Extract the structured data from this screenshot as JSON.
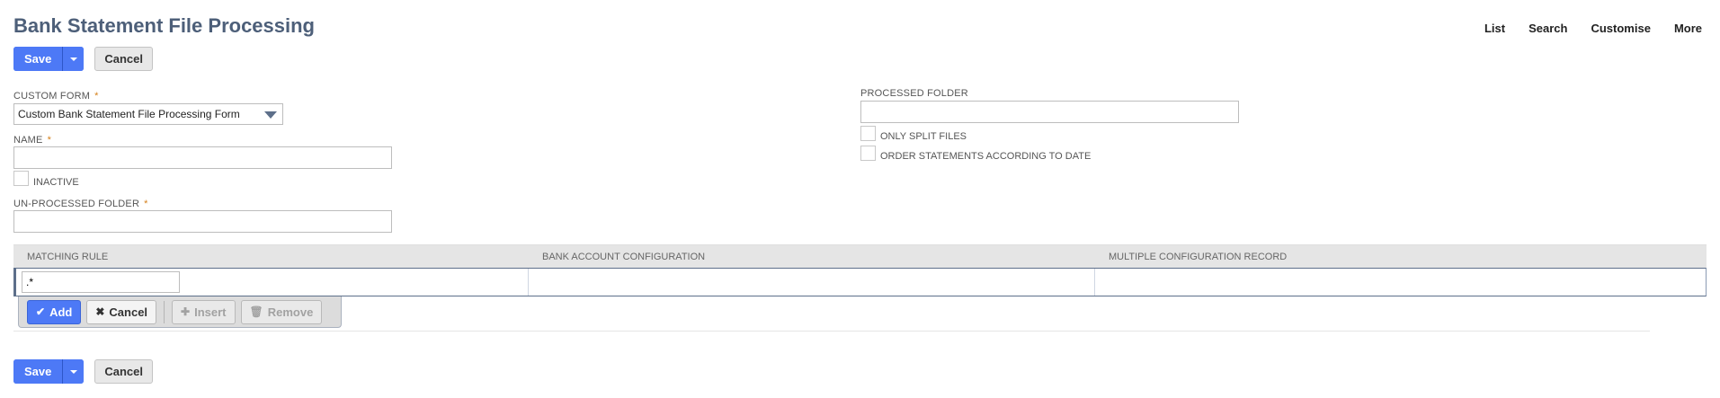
{
  "page": {
    "title": "Bank Statement File Processing"
  },
  "nav": {
    "list": "List",
    "search": "Search",
    "customise": "Customise",
    "more": "More"
  },
  "buttons": {
    "save": "Save",
    "cancel": "Cancel"
  },
  "form": {
    "custom_form": {
      "label": "CUSTOM FORM",
      "required": "*",
      "value": "Custom Bank Statement File Processing Form"
    },
    "name": {
      "label": "NAME",
      "required": "*",
      "value": ""
    },
    "inactive": {
      "label": "INACTIVE",
      "checked": false
    },
    "unprocessed_folder": {
      "label": "UN-PROCESSED FOLDER",
      "required": "*",
      "value": ""
    },
    "processed_folder": {
      "label": "PROCESSED FOLDER",
      "value": ""
    },
    "only_split_files": {
      "label": "ONLY SPLIT FILES",
      "checked": false
    },
    "order_statements": {
      "label": "ORDER STATEMENTS ACCORDING TO DATE",
      "checked": false
    }
  },
  "sublist": {
    "columns": [
      "MATCHING RULE",
      "BANK ACCOUNT CONFIGURATION",
      "MULTIPLE CONFIGURATION RECORD"
    ],
    "edit_row": {
      "matching_rule": ".*",
      "bank_account_configuration": "",
      "multiple_configuration_record": ""
    },
    "toolbar": {
      "add": "Add",
      "cancel": "Cancel",
      "insert": "Insert",
      "remove": "Remove"
    }
  },
  "colors": {
    "primary": "#4d79f6",
    "title": "#4d5f79",
    "required": "#d5811b"
  }
}
